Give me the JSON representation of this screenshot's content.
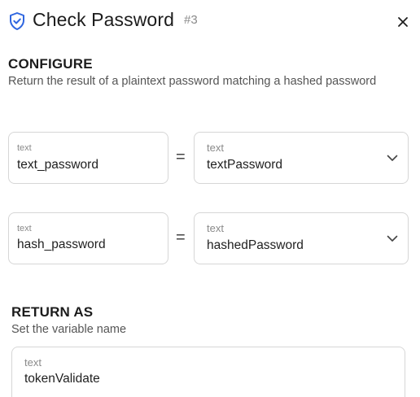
{
  "header": {
    "title": "Check Password",
    "step_number": "#3",
    "icons": {
      "leading": "shield-check-icon",
      "close": "close-icon"
    }
  },
  "configure": {
    "title": "CONFIGURE",
    "description": "Return the result of a plaintext password matching a hashed password",
    "rows": [
      {
        "param": {
          "type_label": "text",
          "value": "text_password"
        },
        "operator": "=",
        "argument": {
          "type_label": "text",
          "value": "textPassword"
        }
      },
      {
        "param": {
          "type_label": "text",
          "value": "hash_password"
        },
        "operator": "=",
        "argument": {
          "type_label": "text",
          "value": "hashedPassword"
        }
      }
    ]
  },
  "return_as": {
    "title": "RETURN AS",
    "description": "Set the variable name",
    "field": {
      "type_label": "text",
      "value": "tokenValidate"
    }
  },
  "colors": {
    "accent": "#2f66e0",
    "border": "#d6d6d6",
    "muted_text": "#8a8a8a"
  }
}
